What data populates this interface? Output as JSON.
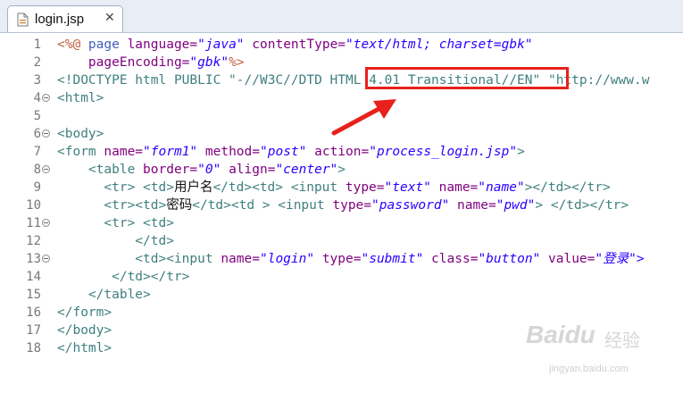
{
  "tab": {
    "title": "login.jsp",
    "close_glyph": "✕",
    "icon": "jsp-file-icon"
  },
  "annotation": {
    "color": "#e8211d"
  },
  "lines": [
    {
      "n": "1",
      "fold": false,
      "tokens": [
        {
          "t": "<%@ ",
          "c": "dir"
        },
        {
          "t": "page",
          "c": "kw"
        },
        {
          "t": " language=",
          "c": "at"
        },
        {
          "t": "\"java\"",
          "c": "vl"
        },
        {
          "t": " contentType=",
          "c": "at"
        },
        {
          "t": "\"text/html; charset=gbk\"",
          "c": "vl"
        }
      ]
    },
    {
      "n": "2",
      "fold": false,
      "tokens": [
        {
          "t": "    pageEncoding=",
          "c": "at"
        },
        {
          "t": "\"gbk\"",
          "c": "vl"
        },
        {
          "t": "%>",
          "c": "dir"
        }
      ]
    },
    {
      "n": "3",
      "fold": false,
      "tokens": [
        {
          "t": "<!DOCTYPE html PUBLIC \"-//W3C//DTD HTML 4.01 Transitional//EN\" \"http://www.w",
          "c": "tg"
        }
      ]
    },
    {
      "n": "4",
      "fold": true,
      "tokens": [
        {
          "t": "<html>",
          "c": "tg"
        }
      ]
    },
    {
      "n": "5",
      "fold": false,
      "tokens": []
    },
    {
      "n": "6",
      "fold": true,
      "tokens": [
        {
          "t": "<body>",
          "c": "tg"
        }
      ]
    },
    {
      "n": "7",
      "fold": false,
      "tokens": [
        {
          "t": "<form ",
          "c": "tg"
        },
        {
          "t": "name=",
          "c": "at"
        },
        {
          "t": "\"form1\"",
          "c": "vl"
        },
        {
          "t": " method=",
          "c": "at"
        },
        {
          "t": "\"post\"",
          "c": "vl"
        },
        {
          "t": " action=",
          "c": "at"
        },
        {
          "t": "\"process_login.jsp\"",
          "c": "vl"
        },
        {
          "t": ">",
          "c": "tg"
        }
      ]
    },
    {
      "n": "8",
      "fold": true,
      "tokens": [
        {
          "t": "    <table ",
          "c": "tg"
        },
        {
          "t": "border=",
          "c": "at"
        },
        {
          "t": "\"0\"",
          "c": "vl"
        },
        {
          "t": " align=",
          "c": "at"
        },
        {
          "t": "\"center\"",
          "c": "vl"
        },
        {
          "t": ">",
          "c": "tg"
        }
      ]
    },
    {
      "n": "9",
      "fold": false,
      "tokens": [
        {
          "t": "      <tr> <td>",
          "c": "tg"
        },
        {
          "t": "用户名",
          "c": "plain"
        },
        {
          "t": "</td><td> <input ",
          "c": "tg"
        },
        {
          "t": "type=",
          "c": "at"
        },
        {
          "t": "\"text\"",
          "c": "vl"
        },
        {
          "t": " name=",
          "c": "at"
        },
        {
          "t": "\"name\"",
          "c": "vl"
        },
        {
          "t": "></td></tr>",
          "c": "tg"
        }
      ]
    },
    {
      "n": "10",
      "fold": false,
      "tokens": [
        {
          "t": "      <tr><td>",
          "c": "tg"
        },
        {
          "t": "密码",
          "c": "plain"
        },
        {
          "t": "</td><td > <input ",
          "c": "tg"
        },
        {
          "t": "type=",
          "c": "at"
        },
        {
          "t": "\"password\"",
          "c": "vl"
        },
        {
          "t": " name=",
          "c": "at"
        },
        {
          "t": "\"pwd\"",
          "c": "vl"
        },
        {
          "t": "> </td></tr>",
          "c": "tg"
        }
      ]
    },
    {
      "n": "11",
      "fold": true,
      "tokens": [
        {
          "t": "      <tr> <td>",
          "c": "tg"
        }
      ]
    },
    {
      "n": "12",
      "fold": false,
      "tokens": [
        {
          "t": "          </td>",
          "c": "tg"
        }
      ]
    },
    {
      "n": "13",
      "fold": true,
      "tokens": [
        {
          "t": "          <td><input ",
          "c": "tg"
        },
        {
          "t": "name=",
          "c": "at"
        },
        {
          "t": "\"login\"",
          "c": "vl"
        },
        {
          "t": " type=",
          "c": "at"
        },
        {
          "t": "\"submit\"",
          "c": "vl"
        },
        {
          "t": " class=",
          "c": "at"
        },
        {
          "t": "\"button\"",
          "c": "vl"
        },
        {
          "t": " value=",
          "c": "at"
        },
        {
          "t": "\"登录\">",
          "c": "vl"
        }
      ]
    },
    {
      "n": "14",
      "fold": false,
      "tokens": [
        {
          "t": "       </td></tr>",
          "c": "tg"
        }
      ]
    },
    {
      "n": "15",
      "fold": false,
      "tokens": [
        {
          "t": "    </table>",
          "c": "tg"
        }
      ]
    },
    {
      "n": "16",
      "fold": false,
      "tokens": [
        {
          "t": "</form>",
          "c": "tg"
        }
      ]
    },
    {
      "n": "17",
      "fold": false,
      "tokens": [
        {
          "t": "</body>",
          "c": "tg"
        }
      ]
    },
    {
      "n": "18",
      "fold": false,
      "tokens": [
        {
          "t": "</html>",
          "c": "tg"
        }
      ]
    }
  ],
  "watermark": {
    "brand": "Baidu",
    "cn": "经验",
    "url": "jingyan.baidu.com"
  }
}
